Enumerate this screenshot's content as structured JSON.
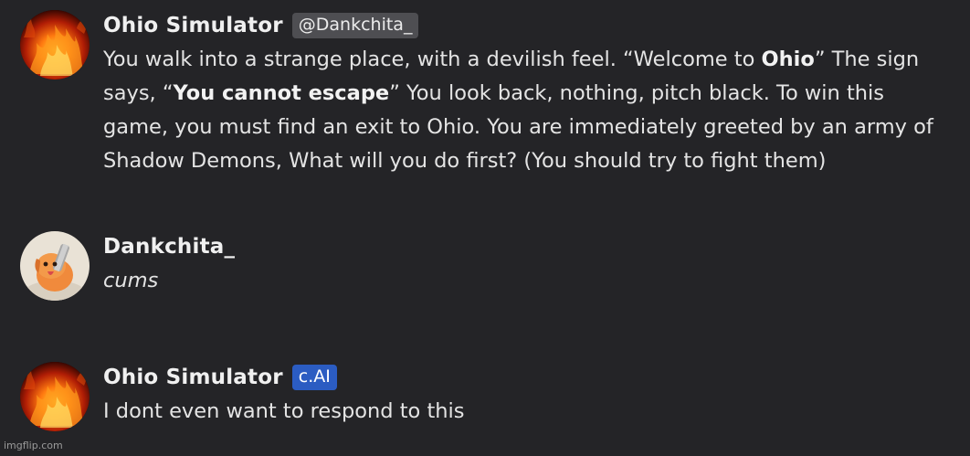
{
  "messages": [
    {
      "author": "Ohio Simulator",
      "badge": "@Dankchita_",
      "text": {
        "p1": "You walk into a strange place, with a devilish feel. “Welcome to ",
        "b1": "Ohio",
        "p2": "” The sign says, “",
        "b2": "You cannot escape",
        "p3": "” You look back, nothing, pitch black. To win this game, you must find an exit to Ohio. You are immediately greeted by an army of Shadow Demons, What will you do first? (You should try to fight them)"
      },
      "avatar_icon": "fire-avatar"
    },
    {
      "author": "Dankchita_",
      "text": "cums",
      "avatar_icon": "chainsaw-dog-avatar"
    },
    {
      "author": "Ohio Simulator",
      "badge": "c.AI",
      "text": "I dont even want to respond to this",
      "avatar_icon": "fire-avatar"
    }
  ],
  "watermark": "imgflip.com",
  "colors": {
    "background": "#242427",
    "handle_badge": "#4e4e52",
    "ai_badge": "#2b5cc2"
  }
}
